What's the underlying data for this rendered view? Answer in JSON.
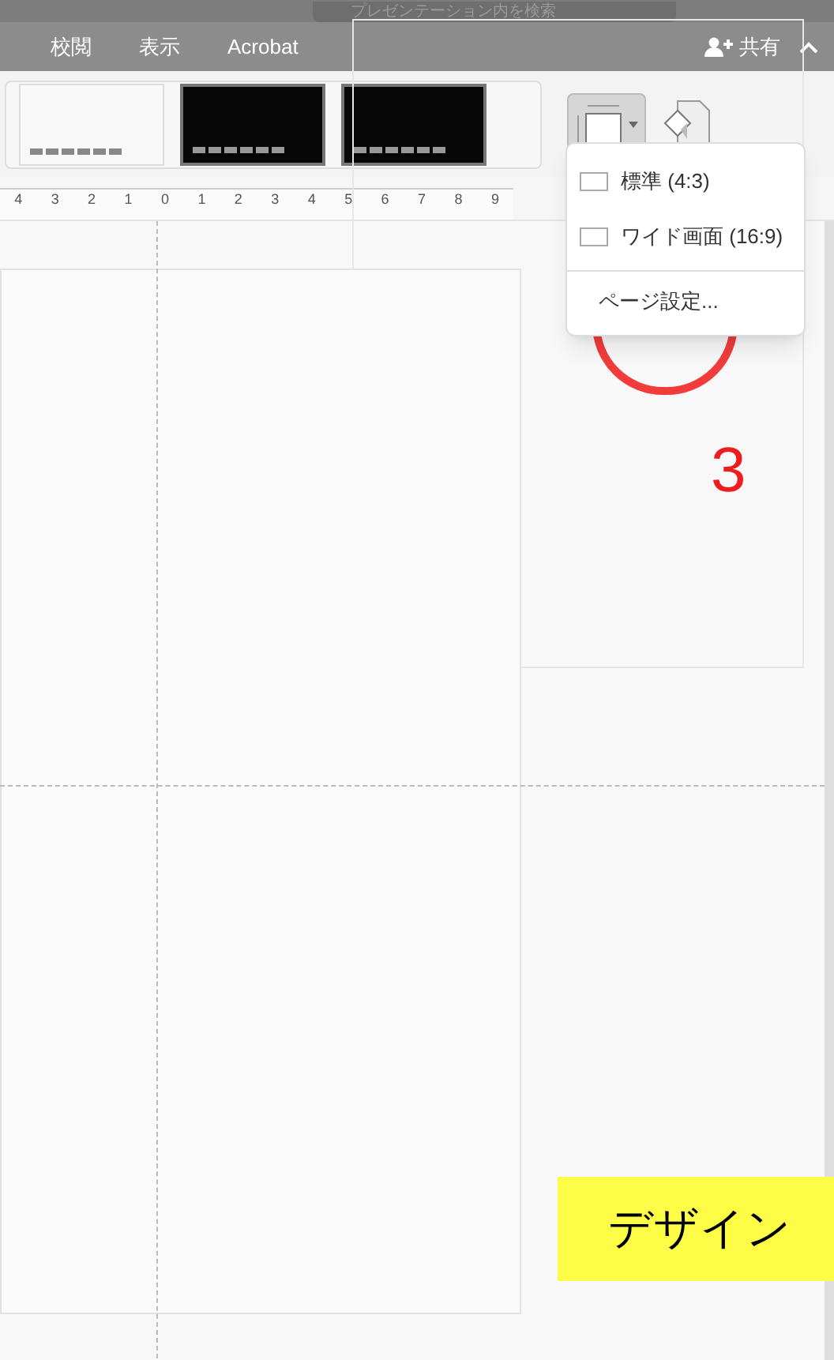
{
  "search": {
    "placeholder": "プレゼンテーション内を検索"
  },
  "tabs": [
    {
      "label": "校閲"
    },
    {
      "label": "表示"
    },
    {
      "label": "Acrobat"
    }
  ],
  "share_button": {
    "label": "共有"
  },
  "themes": [
    {
      "kind": "light"
    },
    {
      "kind": "dark"
    },
    {
      "kind": "dark"
    }
  ],
  "slide_size_button": {
    "pressed": true
  },
  "ruler": [
    "4",
    "3",
    "2",
    "1",
    "0",
    "1",
    "2",
    "3",
    "4",
    "5",
    "6",
    "7",
    "8",
    "9"
  ],
  "slide_size_menu": {
    "items": [
      {
        "kind": "option",
        "label": "標準 (4:3)"
      },
      {
        "kind": "option",
        "label": "ワイド画面 (16:9)"
      },
      {
        "kind": "command",
        "label": "ページ設定..."
      }
    ]
  },
  "annotation": {
    "step": "3",
    "caption": "デザイン"
  }
}
